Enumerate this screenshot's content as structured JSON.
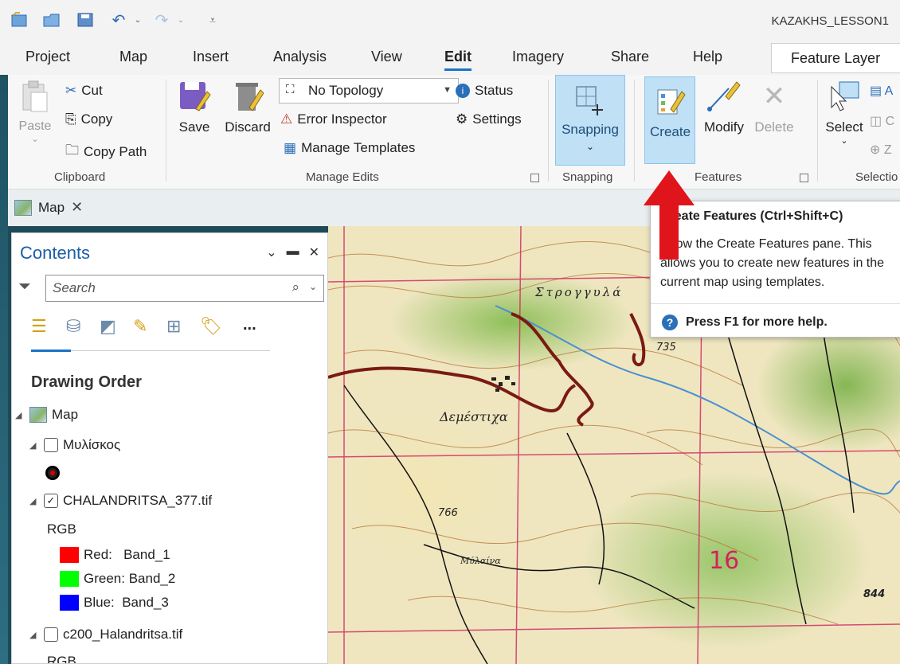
{
  "window": {
    "title": "KAZAKHS_LESSON1"
  },
  "tabs": [
    {
      "label": "Project"
    },
    {
      "label": "Map"
    },
    {
      "label": "Insert"
    },
    {
      "label": "Analysis"
    },
    {
      "label": "View"
    },
    {
      "label": "Edit"
    },
    {
      "label": "Imagery"
    },
    {
      "label": "Share"
    },
    {
      "label": "Help"
    }
  ],
  "contextual_tab": "Feature Layer",
  "ribbon": {
    "clipboard": {
      "paste": "Paste",
      "cut": "Cut",
      "copy": "Copy",
      "copy_path": "Copy Path",
      "group": "Clipboard"
    },
    "manage_edits": {
      "save": "Save",
      "discard": "Discard",
      "topology": "No Topology",
      "error_inspector": "Error Inspector",
      "manage_templates": "Manage Templates",
      "status": "Status",
      "settings": "Settings",
      "group": "Manage Edits"
    },
    "snapping": {
      "button": "Snapping",
      "group": "Snapping"
    },
    "features": {
      "create": "Create",
      "modify": "Modify",
      "delete": "Delete",
      "group": "Features"
    },
    "selection": {
      "select": "Select",
      "group": "Selectio"
    }
  },
  "map_tab": {
    "label": "Map"
  },
  "contents": {
    "title": "Contents",
    "search_placeholder": "Search",
    "more": "...",
    "drawing_order": "Drawing Order",
    "layers": {
      "map": "Map",
      "mylyskos": "Μυλίσκος",
      "chalandritsa": "CHALANDRITSA_377.tif",
      "rgb1": "RGB",
      "red": "Red:   Band_1",
      "green": "Green: Band_2",
      "blue": "Blue:  Band_3",
      "c200": "c200_Halandritsa.tif",
      "rgb2": "RGB"
    }
  },
  "tooltip": {
    "title": "Create Features (Ctrl+Shift+C)",
    "body": "Show the Create Features pane.  This allows you to create new features in the current map using templates.",
    "help": "Press F1 for more help."
  },
  "map_labels": {
    "village": "Δεμέστιχα",
    "stroggyli": "Στρογγυλά",
    "elev1": "766",
    "elev2": "735",
    "elev3": "844",
    "grid": "16",
    "mylaki": "Μύλαίνα"
  },
  "colors": {
    "accent": "#1a73c8",
    "arrow": "#e0141b",
    "red_band": "#ff0000",
    "green_band": "#00ff00",
    "blue_band": "#0000ff"
  }
}
